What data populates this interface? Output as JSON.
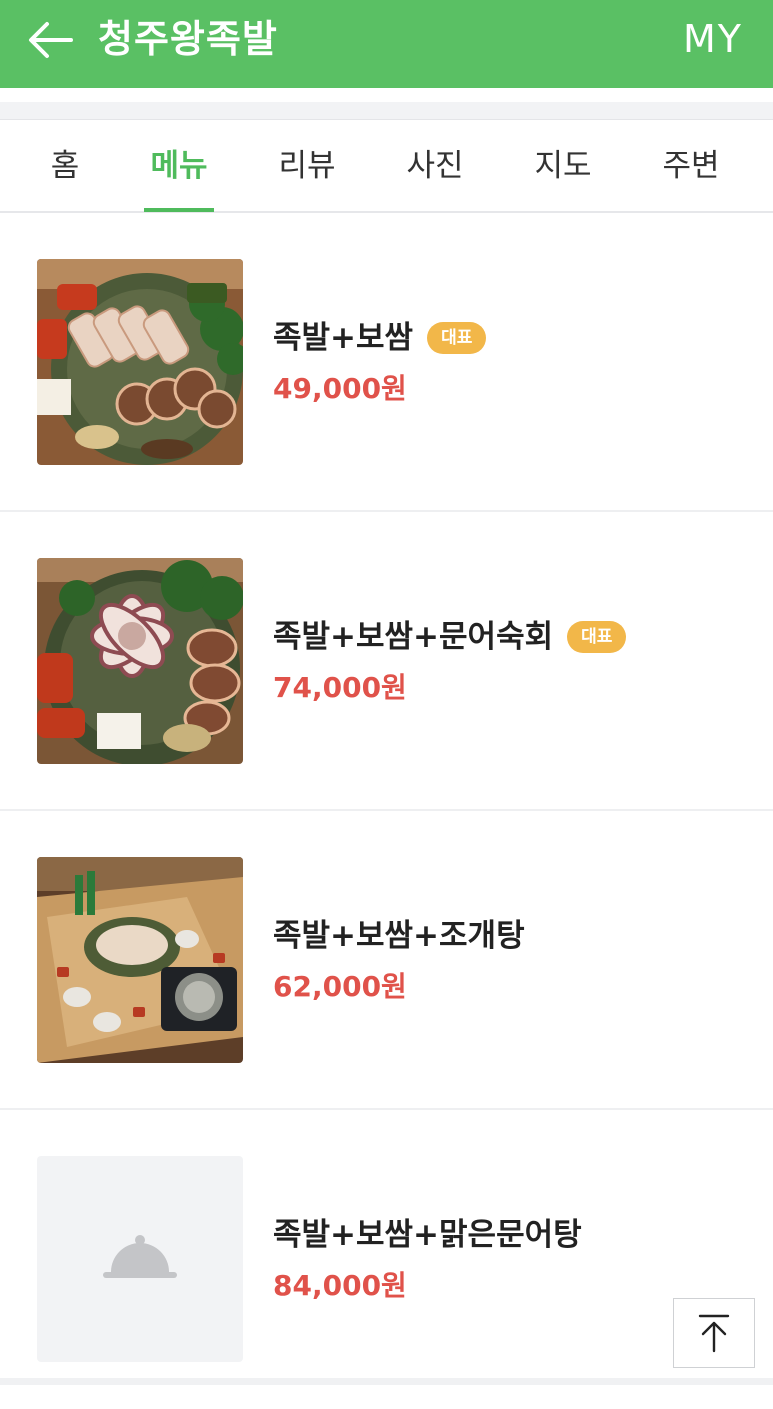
{
  "header": {
    "title": "청주왕족발",
    "my_label": "MY",
    "back_icon": "arrow-left-icon",
    "background": "#5ac064"
  },
  "tabs": [
    {
      "label": "홈",
      "active": false
    },
    {
      "label": "메뉴",
      "active": true
    },
    {
      "label": "리뷰",
      "active": false
    },
    {
      "label": "사진",
      "active": false
    },
    {
      "label": "지도",
      "active": false
    },
    {
      "label": "주변",
      "active": false
    }
  ],
  "menu": [
    {
      "name": "족발+보쌈",
      "badge": "대표",
      "price": "49,000원",
      "image": "pork-platter-photo"
    },
    {
      "name": "족발+보쌈+문어숙회",
      "badge": "대표",
      "price": "74,000원",
      "image": "octopus-platter-photo"
    },
    {
      "name": "족발+보쌈+조개탕",
      "badge": "",
      "price": "62,000원",
      "image": "table-set-photo"
    },
    {
      "name": "족발+보쌈+맑은문어탕",
      "badge": "",
      "price": "84,000원",
      "image": "placeholder-cloche-icon"
    }
  ],
  "scroll_top_icon": "arrow-up-to-top-icon",
  "colors": {
    "accent": "#4fbb5c",
    "price": "#e0524a",
    "badge": "#f2b749"
  }
}
